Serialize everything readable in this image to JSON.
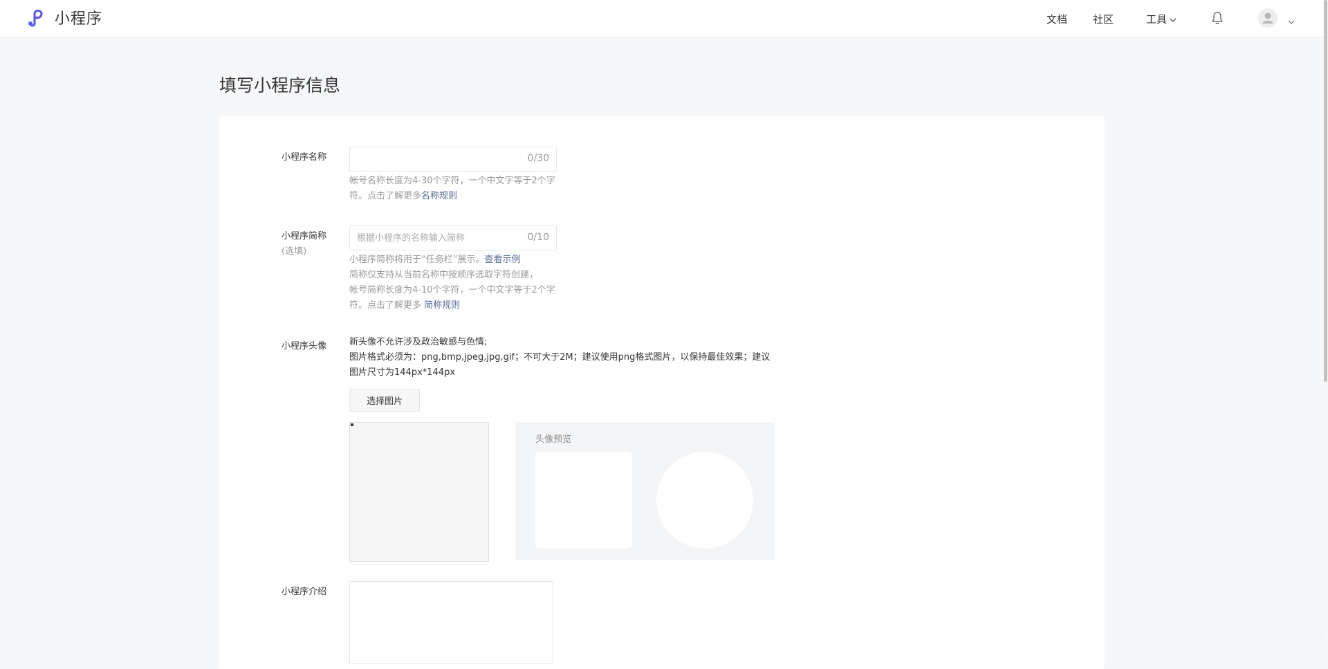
{
  "header": {
    "app_name": "小程序",
    "nav": {
      "docs": "文档",
      "community": "社区",
      "tools": "工具"
    }
  },
  "page": {
    "title": "填写小程序信息"
  },
  "form": {
    "name": {
      "label": "小程序名称",
      "value": "",
      "counter": "0/30",
      "hint_text": "帐号名称长度为4-30个字符，一个中文字等于2个字符。点击了解更多",
      "hint_link": "名称规则"
    },
    "short_name": {
      "label": "小程序简称",
      "label_sub": "(选填)",
      "placeholder": "根据小程序的名称输入简称",
      "value": "",
      "counter": "0/10",
      "hint_line1": "小程序简称将用于“任务栏”展示。",
      "hint_line1_link": "查看示例",
      "hint_line2": "简称仅支持从当前名称中按顺序选取字符创建，",
      "hint_line3": "帐号简称长度为4-10个字符，一个中文字等于2个字符。点击了解更多 ",
      "hint_link": "简称规则"
    },
    "avatar": {
      "label": "小程序头像",
      "desc_line1": "新头像不允许涉及政治敏感与色情;",
      "desc_line2": "图片格式必须为：png,bmp,jpeg,jpg,gif；不可大于2M；建议使用png格式图片，以保持最佳效果；建议图片尺寸为144px*144px",
      "button": "选择图片",
      "preview_title": "头像预览"
    },
    "intro": {
      "label": "小程序介绍",
      "value": ""
    }
  },
  "icons": {
    "logo": "mini-program-logo-icon",
    "bell": "bell-icon",
    "user": "user-avatar-icon",
    "caret": "chevron-down-icon"
  },
  "colors": {
    "logo": "#5b5ee6",
    "link": "#576b95",
    "page_bg": "#f6f7f9"
  }
}
